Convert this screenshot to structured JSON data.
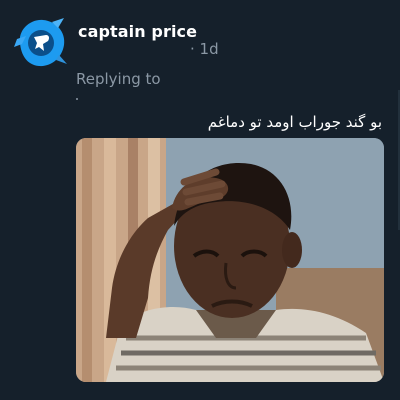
{
  "tweet": {
    "author": {
      "display_name": "captain price",
      "avatar_icon": "blue-bird-badge-icon"
    },
    "meta": {
      "time": "· 1d"
    },
    "reply": {
      "label": "Replying to"
    },
    "text": "بو گند جوراب اومد تو دماغم",
    "media": {
      "kind": "meme-photo"
    }
  },
  "colors": {
    "background": "#15202b",
    "primary_text": "#ffffff",
    "secondary_text": "#8b98a5",
    "avatar_blue": "#1d9bf0"
  }
}
